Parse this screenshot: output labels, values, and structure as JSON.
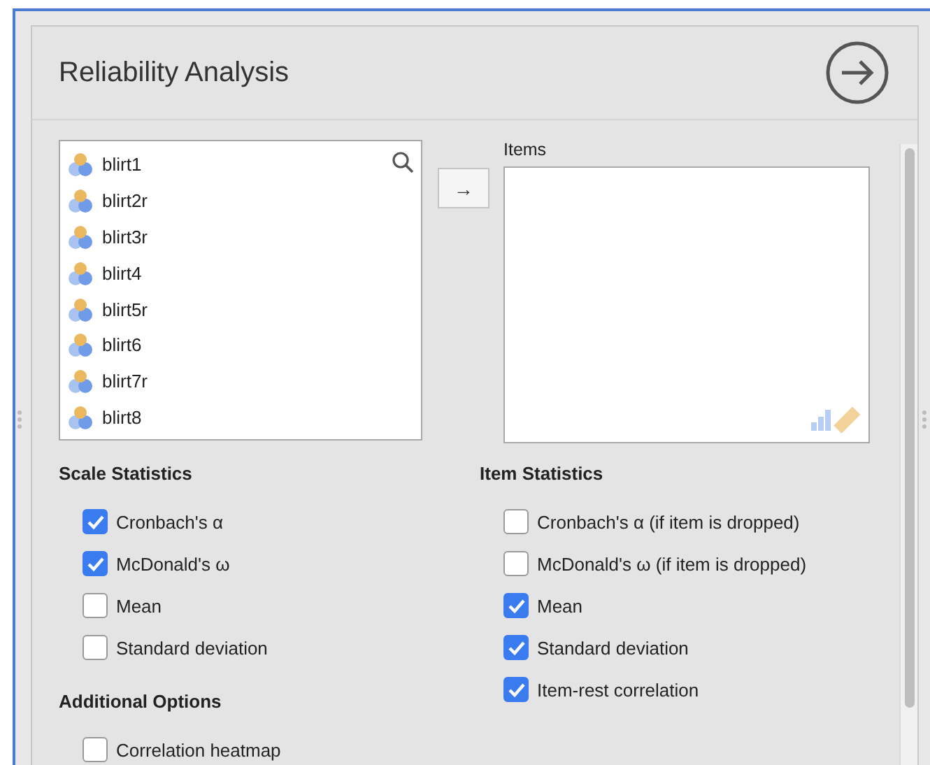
{
  "title": "Reliability Analysis",
  "variables": [
    {
      "name": "blirt1"
    },
    {
      "name": "blirt2r"
    },
    {
      "name": "blirt3r"
    },
    {
      "name": "blirt4"
    },
    {
      "name": "blirt5r"
    },
    {
      "name": "blirt6"
    },
    {
      "name": "blirt7r"
    },
    {
      "name": "blirt8"
    }
  ],
  "items_label": "Items",
  "move_button": "→",
  "scale_statistics": {
    "heading": "Scale Statistics",
    "options": [
      {
        "label": "Cronbach's α",
        "checked": true
      },
      {
        "label": "McDonald's ω",
        "checked": true
      },
      {
        "label": "Mean",
        "checked": false
      },
      {
        "label": "Standard deviation",
        "checked": false
      }
    ]
  },
  "item_statistics": {
    "heading": "Item Statistics",
    "options": [
      {
        "label": "Cronbach's α (if item is dropped)",
        "checked": false
      },
      {
        "label": "McDonald's ω (if item is dropped)",
        "checked": false
      },
      {
        "label": "Mean",
        "checked": true
      },
      {
        "label": "Standard deviation",
        "checked": true
      },
      {
        "label": "Item-rest correlation",
        "checked": true
      }
    ]
  },
  "additional_options": {
    "heading": "Additional Options",
    "options": [
      {
        "label": "Correlation heatmap",
        "checked": false
      }
    ]
  }
}
